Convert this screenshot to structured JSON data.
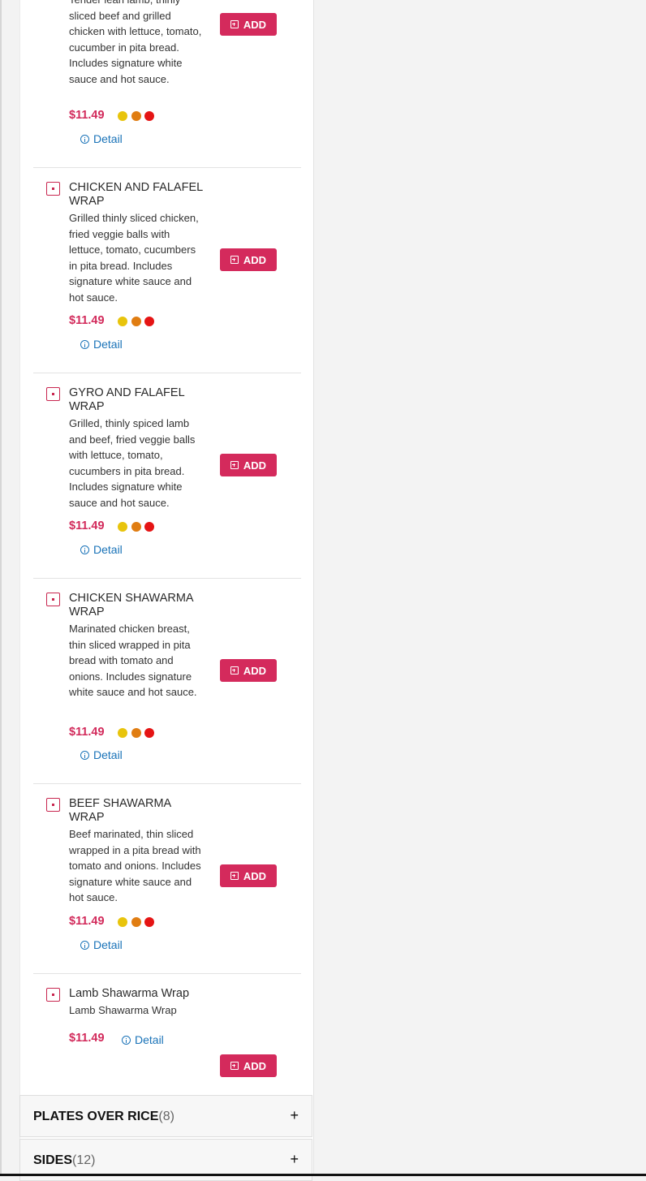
{
  "items": [
    {
      "name": "",
      "description": "Tender lean lamb, thinly sliced beef and grilled chicken with lettuce, tomato, cucumber in pita bread. Includes signature white sauce and hot sauce.",
      "price": "$11.49",
      "detail_label": "Detail",
      "add_label": "ADD"
    },
    {
      "name": "CHICKEN AND FALAFEL WRAP",
      "description": "Grilled thinly sliced chicken, fried veggie balls with lettuce, tomato, cucumbers in pita bread. Includes signature white sauce and hot sauce.",
      "price": "$11.49",
      "detail_label": "Detail",
      "add_label": "ADD"
    },
    {
      "name": "GYRO AND FALAFEL WRAP",
      "description": "Grilled, thinly spiced lamb and beef, fried veggie balls with lettuce, tomato, cucumbers in pita bread. Includes signature white sauce and hot sauce.",
      "price": "$11.49",
      "detail_label": "Detail",
      "add_label": "ADD"
    },
    {
      "name": "CHICKEN SHAWARMA WRAP",
      "description": "Marinated chicken breast, thin sliced wrapped in pita bread with tomato and onions. Includes signature white sauce and hot sauce.",
      "price": "$11.49",
      "detail_label": "Detail",
      "add_label": "ADD"
    },
    {
      "name": "BEEF SHAWARMA WRAP",
      "description": "Beef marinated, thin sliced wrapped in a pita bread with tomato and onions. Includes signature white sauce and hot sauce.",
      "price": "$11.49",
      "detail_label": "Detail",
      "add_label": "ADD"
    },
    {
      "name": "Lamb Shawarma Wrap",
      "description": "Lamb Shawarma Wrap",
      "price": "$11.49",
      "detail_label": "Detail",
      "add_label": "ADD"
    }
  ],
  "heat_colors": [
    "#e8c40c",
    "#e07d12",
    "#e51414"
  ],
  "categories": [
    {
      "title": "PLATES OVER RICE",
      "count": "(8)",
      "toggle": "+"
    },
    {
      "title": "SIDES",
      "count": "(12)",
      "toggle": "+"
    }
  ],
  "theme": {
    "accent": "#d42a5c",
    "link": "#1a73b8"
  }
}
